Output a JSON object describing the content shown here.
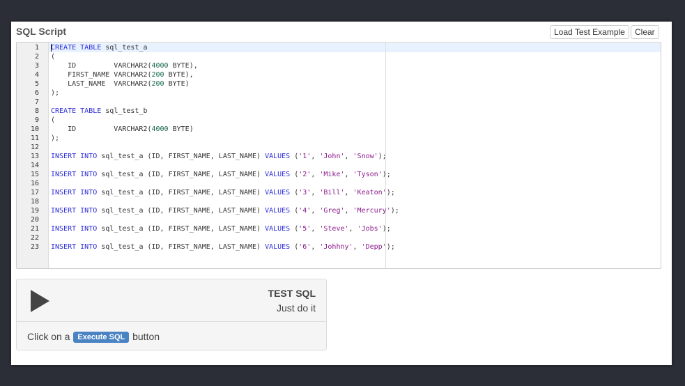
{
  "header": {
    "title": "SQL Script",
    "load_example_label": "Load Test Example",
    "clear_label": "Clear"
  },
  "editor": {
    "lines": [
      [
        {
          "t": "CREATE",
          "c": "kw"
        },
        {
          "t": " "
        },
        {
          "t": "TABLE",
          "c": "kw"
        },
        {
          "t": " sql_test_a"
        }
      ],
      [
        {
          "t": "("
        }
      ],
      [
        {
          "t": "    ID         VARCHAR2("
        },
        {
          "t": "4000",
          "c": "num"
        },
        {
          "t": " BYTE),"
        }
      ],
      [
        {
          "t": "    FIRST_NAME VARCHAR2("
        },
        {
          "t": "200",
          "c": "num"
        },
        {
          "t": " BYTE),"
        }
      ],
      [
        {
          "t": "    LAST_NAME  VARCHAR2("
        },
        {
          "t": "200",
          "c": "num"
        },
        {
          "t": " BYTE)"
        }
      ],
      [
        {
          "t": ");"
        }
      ],
      [],
      [
        {
          "t": "CREATE",
          "c": "kw"
        },
        {
          "t": " "
        },
        {
          "t": "TABLE",
          "c": "kw"
        },
        {
          "t": " sql_test_b"
        }
      ],
      [
        {
          "t": "("
        }
      ],
      [
        {
          "t": "    ID         VARCHAR2("
        },
        {
          "t": "4000",
          "c": "num"
        },
        {
          "t": " BYTE)"
        }
      ],
      [
        {
          "t": ");"
        }
      ],
      [],
      [
        {
          "t": "INSERT",
          "c": "kw"
        },
        {
          "t": " "
        },
        {
          "t": "INTO",
          "c": "kw"
        },
        {
          "t": " sql_test_a (ID, FIRST_NAME, LAST_NAME) "
        },
        {
          "t": "VALUES",
          "c": "kw"
        },
        {
          "t": " ("
        },
        {
          "t": "'1'",
          "c": "str"
        },
        {
          "t": ", "
        },
        {
          "t": "'John'",
          "c": "str"
        },
        {
          "t": ", "
        },
        {
          "t": "'Snow'",
          "c": "str"
        },
        {
          "t": ");"
        }
      ],
      [],
      [
        {
          "t": "INSERT",
          "c": "kw"
        },
        {
          "t": " "
        },
        {
          "t": "INTO",
          "c": "kw"
        },
        {
          "t": " sql_test_a (ID, FIRST_NAME, LAST_NAME) "
        },
        {
          "t": "VALUES",
          "c": "kw"
        },
        {
          "t": " ("
        },
        {
          "t": "'2'",
          "c": "str"
        },
        {
          "t": ", "
        },
        {
          "t": "'Mike'",
          "c": "str"
        },
        {
          "t": ", "
        },
        {
          "t": "'Tyson'",
          "c": "str"
        },
        {
          "t": ");"
        }
      ],
      [],
      [
        {
          "t": "INSERT",
          "c": "kw"
        },
        {
          "t": " "
        },
        {
          "t": "INTO",
          "c": "kw"
        },
        {
          "t": " sql_test_a (ID, FIRST_NAME, LAST_NAME) "
        },
        {
          "t": "VALUES",
          "c": "kw"
        },
        {
          "t": " ("
        },
        {
          "t": "'3'",
          "c": "str"
        },
        {
          "t": ", "
        },
        {
          "t": "'Bill'",
          "c": "str"
        },
        {
          "t": ", "
        },
        {
          "t": "'Keaton'",
          "c": "str"
        },
        {
          "t": ");"
        }
      ],
      [],
      [
        {
          "t": "INSERT",
          "c": "kw"
        },
        {
          "t": " "
        },
        {
          "t": "INTO",
          "c": "kw"
        },
        {
          "t": " sql_test_a (ID, FIRST_NAME, LAST_NAME) "
        },
        {
          "t": "VALUES",
          "c": "kw"
        },
        {
          "t": " ("
        },
        {
          "t": "'4'",
          "c": "str"
        },
        {
          "t": ", "
        },
        {
          "t": "'Greg'",
          "c": "str"
        },
        {
          "t": ", "
        },
        {
          "t": "'Mercury'",
          "c": "str"
        },
        {
          "t": ");"
        }
      ],
      [],
      [
        {
          "t": "INSERT",
          "c": "kw"
        },
        {
          "t": " "
        },
        {
          "t": "INTO",
          "c": "kw"
        },
        {
          "t": " sql_test_a (ID, FIRST_NAME, LAST_NAME) "
        },
        {
          "t": "VALUES",
          "c": "kw"
        },
        {
          "t": " ("
        },
        {
          "t": "'5'",
          "c": "str"
        },
        {
          "t": ", "
        },
        {
          "t": "'Steve'",
          "c": "str"
        },
        {
          "t": ", "
        },
        {
          "t": "'Jobs'",
          "c": "str"
        },
        {
          "t": ");"
        }
      ],
      [],
      [
        {
          "t": "INSERT",
          "c": "kw"
        },
        {
          "t": " "
        },
        {
          "t": "INTO",
          "c": "kw"
        },
        {
          "t": " sql_test_a (ID, FIRST_NAME, LAST_NAME) "
        },
        {
          "t": "VALUES",
          "c": "kw"
        },
        {
          "t": " ("
        },
        {
          "t": "'6'",
          "c": "str"
        },
        {
          "t": ", "
        },
        {
          "t": "'Johhny'",
          "c": "str"
        },
        {
          "t": ", "
        },
        {
          "t": "'Depp'",
          "c": "str"
        },
        {
          "t": ");"
        }
      ]
    ]
  },
  "card": {
    "title": "TEST SQL",
    "subtitle": "Just do it",
    "instruction_prefix": "Click on a",
    "execute_label": "Execute SQL",
    "instruction_suffix": "button"
  },
  "colors": {
    "background": "#2b2e36",
    "keyword": "#2a2ad8",
    "number": "#116644",
    "string": "#8a1a8a",
    "execute_badge": "#4a83c4"
  }
}
